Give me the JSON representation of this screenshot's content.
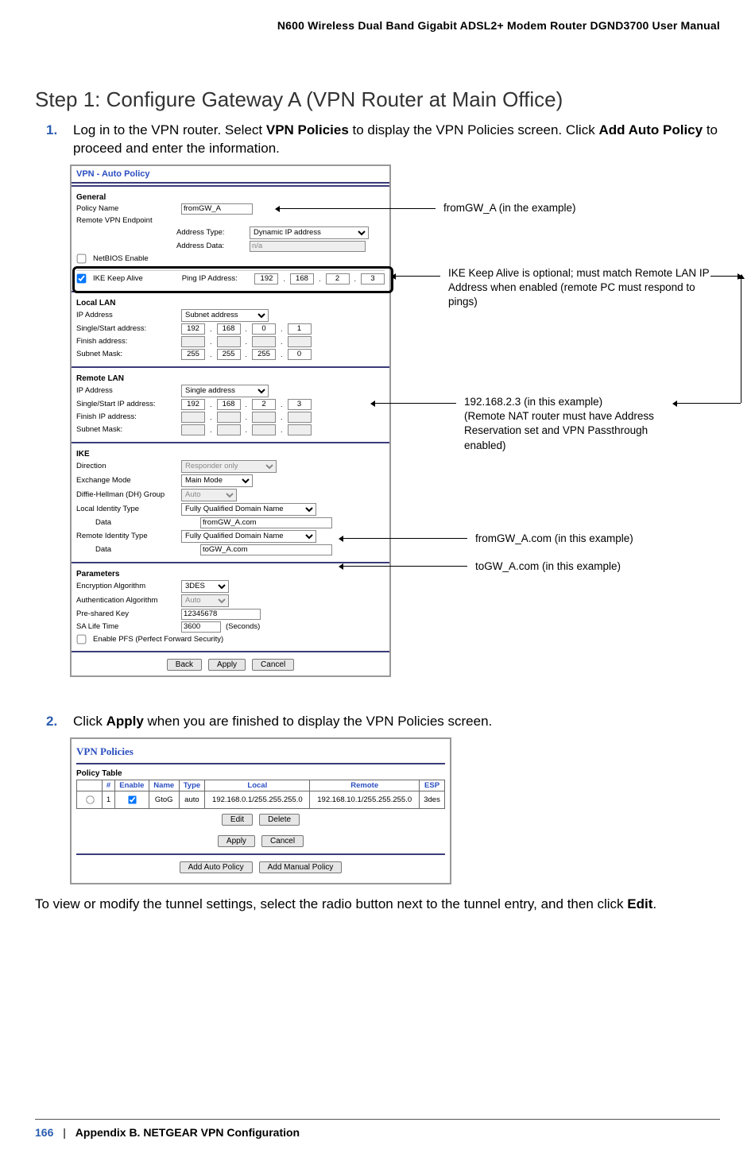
{
  "header": "N600 Wireless Dual Band Gigabit ADSL2+ Modem Router DGND3700 User Manual",
  "title": "Step 1: Configure Gateway A (VPN Router at Main Office)",
  "steps": {
    "s1": {
      "num": "1.",
      "pre": "Log in to the VPN router. Select ",
      "b1": "VPN Policies",
      "mid": " to display the VPN Policies screen. Click ",
      "b2": "Add Auto Policy",
      "post": " to proceed and enter the information."
    },
    "s2": {
      "num": "2.",
      "pre": "Click ",
      "b1": "Apply",
      "post": " when you are finished to display the VPN Policies screen."
    }
  },
  "afterPara": {
    "pre": "To view or modify the tunnel settings, select the radio button next to the tunnel entry, and then click ",
    "b1": "Edit",
    "post": "."
  },
  "callouts": {
    "c1": "fromGW_A (in the example)",
    "c2": "IKE Keep Alive is optional; must match Remote LAN IP Address when enabled (remote PC must respond to pings)",
    "c3": "192.168.2.3 (in this example)\n(Remote NAT router must have Address Reservation set and VPN Passthrough enabled)",
    "c4": "fromGW_A.com (in this example)",
    "c5": "toGW_A.com (in this example)"
  },
  "vpnAuto": {
    "title": "VPN - Auto Policy",
    "general": "General",
    "policyNameLab": "Policy Name",
    "policyName": "fromGW_A",
    "remoteEndpointLab": "Remote VPN Endpoint",
    "addrTypeLab": "Address Type:",
    "addrType": "Dynamic IP address",
    "addrDataLab": "Address Data:",
    "addrData": "n/a",
    "netbios": "NetBIOS Enable",
    "ikeKeepLab": "IKE Keep Alive",
    "pingLab": "Ping IP Address:",
    "pingOct": [
      "192",
      "168",
      "2",
      "3"
    ],
    "localLan": "Local LAN",
    "ipAddrLab": "IP Address",
    "localType": "Subnet address",
    "ssLab": "Single/Start address:",
    "ssOct": [
      "192",
      "168",
      "0",
      "1"
    ],
    "finLab": "Finish address:",
    "finOct": [
      "",
      "",
      "",
      ""
    ],
    "maskLab": "Subnet Mask:",
    "maskOct": [
      "255",
      "255",
      "255",
      "0"
    ],
    "remoteLan": "Remote LAN",
    "remoteType": "Single address",
    "rssLab": "Single/Start IP address:",
    "rssOct": [
      "192",
      "168",
      "2",
      "3"
    ],
    "rfinLab": "Finish IP address:",
    "rfinOct": [
      "",
      "",
      "",
      ""
    ],
    "rmaskLab": "Subnet Mask:",
    "rmaskOct": [
      "",
      "",
      "",
      ""
    ],
    "ike": "IKE",
    "dirLab": "Direction",
    "dir": "Responder only",
    "exLab": "Exchange Mode",
    "ex": "Main Mode",
    "dhLab": "Diffie-Hellman (DH) Group",
    "dh": "Auto",
    "litLab": "Local Identity Type",
    "lit": "Fully Qualified Domain Name",
    "litDataLab": "Data",
    "litData": "fromGW_A.com",
    "ritLab": "Remote Identity Type",
    "rit": "Fully Qualified Domain Name",
    "ritDataLab": "Data",
    "ritData": "toGW_A.com",
    "params": "Parameters",
    "encLab": "Encryption Algorithm",
    "enc": "3DES",
    "authLab": "Authentication Algorithm",
    "auth": "Auto",
    "pskLab": "Pre-shared Key",
    "psk": "12345678",
    "saLab": "SA Life Time",
    "sa": "3600",
    "saSec": "(Seconds)",
    "pfs": "Enable PFS (Perfect Forward Security)",
    "back": "Back",
    "apply": "Apply",
    "cancel": "Cancel"
  },
  "vpnPolicies": {
    "title": "VPN Policies",
    "tableLabel": "Policy Table",
    "cols": [
      "",
      "#",
      "Enable",
      "Name",
      "Type",
      "Local",
      "Remote",
      "ESP"
    ],
    "row": {
      "radio": "",
      "num": "1",
      "enable": true,
      "name": "GtoG",
      "type": "auto",
      "local": "192.168.0.1/255.255.255.0",
      "remote": "192.168.10.1/255.255.255.0",
      "esp": "3des"
    },
    "edit": "Edit",
    "delete": "Delete",
    "apply": "Apply",
    "cancel": "Cancel",
    "addAuto": "Add Auto Policy",
    "addManual": "Add Manual Policy"
  },
  "footer": {
    "page": "166",
    "sep": "|",
    "appendix": "Appendix B.  NETGEAR VPN Configuration"
  }
}
